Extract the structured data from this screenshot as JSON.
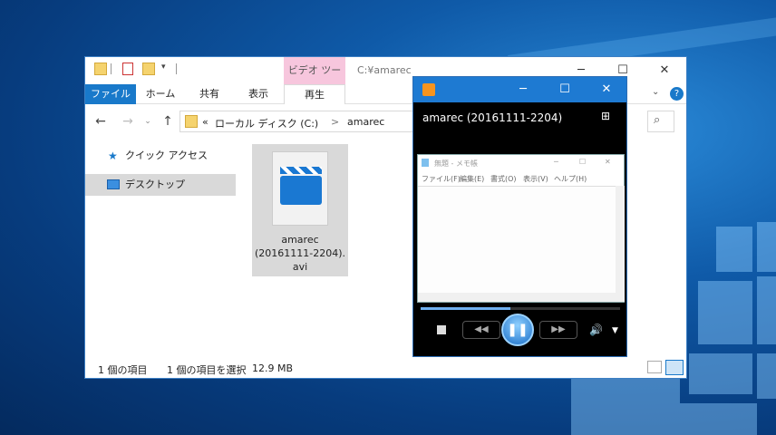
{
  "explorer": {
    "path_title": "C:¥amarec",
    "context_tab": "ビデオ ツール",
    "tabs": [
      "ファイル",
      "ホーム",
      "共有",
      "表示",
      "再生"
    ],
    "address": {
      "prefix": "«",
      "drive": "ローカル ディスク (C:)",
      "sep": ">",
      "folder": "amarec"
    },
    "sidebar": [
      "クイック アクセス",
      "デスクトップ"
    ],
    "file": {
      "name": "amarec\n(20161111-2204).\navi"
    },
    "status": {
      "count": "1 個の項目",
      "selected": "1 個の項目を選択",
      "size": "12.9 MB"
    }
  },
  "player": {
    "title": "amarec (20161111-2204)",
    "notepad_title": "無題 - メモ帳",
    "notepad_menu": [
      "ファイル(F)",
      "編集(E)",
      "書式(O)",
      "表示(V)",
      "ヘルプ(H)"
    ],
    "progress": 0.45
  },
  "colors": {
    "accent": "#1979ca",
    "context": "#f7c6dd",
    "player_bar": "#1e7ad2"
  }
}
